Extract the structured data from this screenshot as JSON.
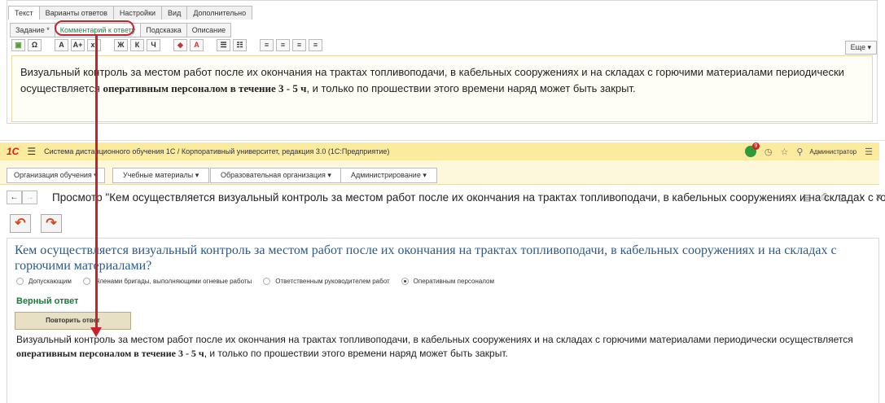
{
  "editor": {
    "tabs": [
      "Текст",
      "Варианты ответов",
      "Настройки",
      "Вид",
      "Дополнительно"
    ],
    "subtabs": [
      "Задание *",
      "Комментарий к ответу",
      "Подсказка",
      "Описание"
    ],
    "toolbar": [
      "▣",
      "Ω",
      "A",
      "A+",
      "x²",
      "Ж",
      "К",
      "Ч",
      "◆",
      "A",
      "☰",
      "☷",
      "≡",
      "≡",
      "≡",
      "≡"
    ],
    "more_label": "Еще ▾",
    "text_before": "Визуальный контроль за местом работ после их окончания на трактах топливоподачи, в кабельных сооружениях и на складах с горючими материалами периодически осуществляется ",
    "text_bold": "оперативным персоналом в течение 3 - 5 ч",
    "text_after": ", и только по прошествии этого времени наряд может быть закрыт."
  },
  "app": {
    "logo": "1С",
    "title": "Система дистанционного обучения 1С / Корпоративный университет, редакция 3.0  (1С:Предприятие)",
    "notif_count": "9",
    "user": "Администратор",
    "menu": [
      "Организация обучения ▾",
      "Учебные материалы ▾",
      "Образовательная организация ▾",
      "Администрирование ▾"
    ],
    "page_title": "Просмотр \"Кем осуществляется визуальный контроль за местом работ после их окончания на трактах топливоподачи, в кабельных сооружениях и на складах с гор...",
    "question": "Кем осуществляется визуальный контроль за местом работ после их окончания на трактах топливоподачи, в кабельных сооружениях и на складах с горючими материалами?",
    "options": [
      {
        "label": "Допускающим",
        "selected": false
      },
      {
        "label": "Членами бригады, выполняющими огневые работы",
        "selected": false
      },
      {
        "label": "Ответственным руководителем работ",
        "selected": false
      },
      {
        "label": "Оперативным персоналом",
        "selected": true
      }
    ],
    "correct_label": "Верный ответ",
    "repeat_label": "Повторить ответ",
    "comment_before": "Визуальный контроль за местом работ после их окончания на трактах топливоподачи, в кабельных сооружениях и на складах с горючими материалами периодически осуществляется ",
    "comment_bold": "оперативным персоналом в течение 3 - 5 ч",
    "comment_after": ", и только по прошествии этого времени наряд может быть закрыт."
  },
  "colors": {
    "accent": "#c8232c",
    "titlebar": "#fbeb9f",
    "question": "#2e5a86",
    "correct": "#1a7a3a"
  }
}
